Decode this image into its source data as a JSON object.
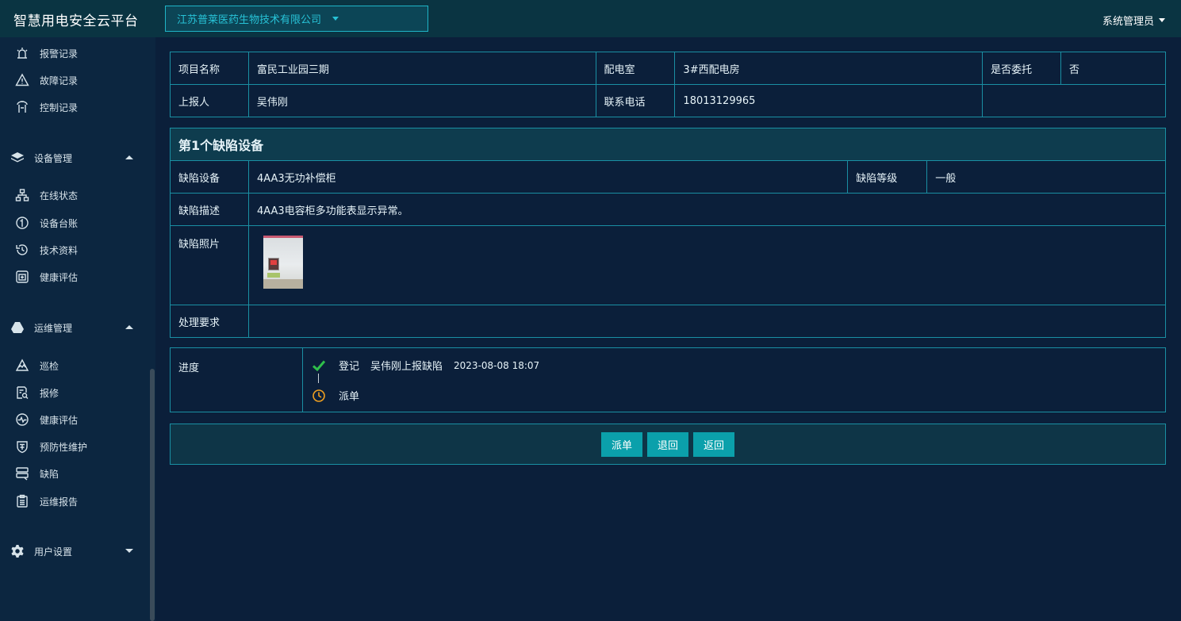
{
  "header": {
    "app_title": "智慧用电安全云平台",
    "company": "江苏普莱医药生物技术有限公司",
    "user": "系统管理员"
  },
  "sidebar": {
    "top_items": [
      {
        "label": "报警记录",
        "icon": "alarm-icon"
      },
      {
        "label": "故障记录",
        "icon": "warning-icon"
      },
      {
        "label": "控制记录",
        "icon": "control-icon"
      }
    ],
    "group_device": {
      "label": "设备管理",
      "icon": "layers-icon",
      "expanded": true
    },
    "device_items": [
      {
        "label": "在线状态",
        "icon": "network-icon"
      },
      {
        "label": "设备台账",
        "icon": "ledger-icon"
      },
      {
        "label": "技术资料",
        "icon": "history-icon"
      },
      {
        "label": "健康评估",
        "icon": "health-icon"
      }
    ],
    "group_ops": {
      "label": "运维管理",
      "icon": "drive-icon",
      "expanded": true
    },
    "ops_items": [
      {
        "label": "巡检",
        "icon": "patrol-icon"
      },
      {
        "label": "报修",
        "icon": "repair-icon"
      },
      {
        "label": "健康评估",
        "icon": "pulse-icon"
      },
      {
        "label": "预防性维护",
        "icon": "shield-icon"
      },
      {
        "label": "缺陷",
        "icon": "defect-icon"
      },
      {
        "label": "运维报告",
        "icon": "report-icon"
      }
    ],
    "group_user": {
      "label": "用户设置",
      "icon": "gear-icon",
      "expanded": false
    }
  },
  "info": {
    "project_label": "项目名称",
    "project_value": "富民工业园三期",
    "room_label": "配电室",
    "room_value": "3#西配电房",
    "entrust_label": "是否委托",
    "entrust_value": "否",
    "reporter_label": "上报人",
    "reporter_value": "吴伟刚",
    "phone_label": "联系电话",
    "phone_value": "18013129965"
  },
  "defect": {
    "section_title": "第1个缺陷设备",
    "device_label": "缺陷设备",
    "device_value": "4AA3无功补偿柜",
    "level_label": "缺陷等级",
    "level_value": "一般",
    "desc_label": "缺陷描述",
    "desc_value": "4AA3电容柜多功能表显示异常。",
    "photo_label": "缺陷照片",
    "requirement_label": "处理要求",
    "requirement_value": ""
  },
  "progress": {
    "label": "进度",
    "steps": [
      {
        "status": "done",
        "name": "登记",
        "detail": "吴伟刚上报缺陷",
        "time": "2023-08-08 18:07"
      },
      {
        "status": "pending",
        "name": "派单"
      }
    ]
  },
  "actions": {
    "dispatch": "派单",
    "reject": "退回",
    "back": "返回"
  },
  "colors": {
    "background": "#0b1f3a",
    "accent": "#0ba0ab",
    "border": "#1a8fa3",
    "done": "#2fbf4a",
    "pending": "#f0a020"
  }
}
